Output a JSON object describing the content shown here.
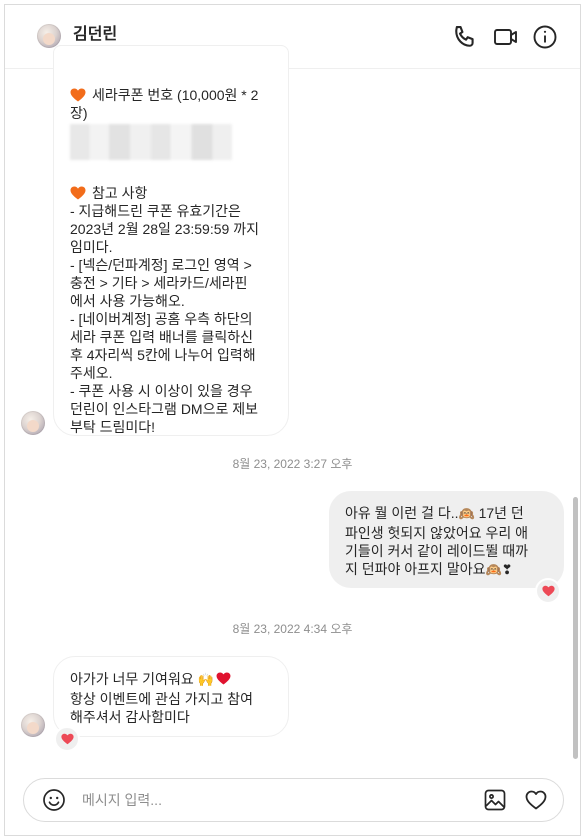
{
  "header": {
    "username": "김던린",
    "call_icon": "phone-icon",
    "video_icon": "video-camera-icon",
    "info_icon": "info-icon"
  },
  "messages": {
    "m1": {
      "coupon_line1": "세라쿠폰 번호 (10,000원 * 2",
      "coupon_line2": "장)",
      "notes_heading": "참고 사항",
      "lines": [
        "- 지급해드린 쿠폰 유효기간은",
        "2023년 2월 28일 23:59:59 까지",
        "임미다.",
        "- [넥슨/던파계정] 로그인 영역 >",
        "충전 > 기타 > 세라카드/세라핀",
        "에서 사용 가능해오.",
        "- [네이버계정] 공홈 우측 하단의",
        "세라 쿠폰 입력 배너를 클릭하신",
        "후 4자리씩 5칸에 나누어 입력해",
        "주세오.",
        "- 쿠폰 사용 시 이상이 있을 경우",
        "던린이 인스타그램 DM으로 제보",
        "부탁 드림미다!"
      ]
    },
    "ts1": "8월 23, 2022 3:27 오후",
    "m2": {
      "l1": "아유 뭘 이런 걸 다..",
      "l1_emoji": "🙉",
      "l1_tail": " 17년 던",
      "l2": "파인생 헛되지 않았어요 우리 애",
      "l3": "기들이 커서 같이 레이드뛸 때까",
      "l4": "지 던파야 아프지 말아요",
      "l4_emoji": "🙉❣"
    },
    "ts2": "8월 23, 2022 4:34 오후",
    "m3": {
      "l1": "아가가 너무 기여워요",
      "l1_emoji": "🙌",
      "l2": "항상 이벤트에 관심 가지고 참여",
      "l3": "해주셔서 감사함미다"
    }
  },
  "composer": {
    "placeholder": "메시지 입력...",
    "emoji_icon": "smiley-icon",
    "image_icon": "image-icon",
    "like_icon": "heart-icon"
  },
  "colors": {
    "reaction_heart": "#ed4956",
    "note_heart": "#f26c1a",
    "bubble_out": "#efefef",
    "timestamp": "#8e8e8e"
  }
}
